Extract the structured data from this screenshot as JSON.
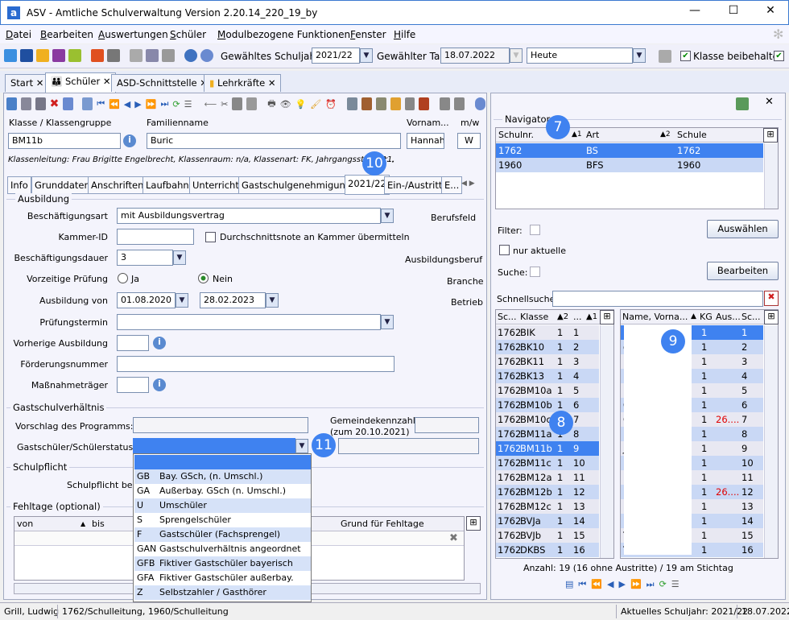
{
  "window": {
    "title": "ASV - Amtliche Schulverwaltung Version 2.20.14_220_19_by",
    "logo": "a",
    "minimize": "—",
    "maximize": "☐",
    "close": "✕"
  },
  "menu": [
    "Datei",
    "Bearbeiten",
    "Auswertungen",
    "Schüler",
    "Modulbezogene Funktionen",
    "Fenster",
    "Hilfe"
  ],
  "toolbar": {
    "schuljahr_label": "Gewähltes Schuljahr",
    "schuljahr_value": "2021/22",
    "tag_label": "Gewählter Tag",
    "tag_value": "18.07.2022",
    "heute_value": "Heute",
    "klasse_label": "Klasse beibehalten"
  },
  "tabs": [
    {
      "label": "Start"
    },
    {
      "label": "Schüler"
    },
    {
      "label": "ASD-Schnittstelle"
    },
    {
      "label": "Lehrkräfte"
    }
  ],
  "tab_close": "✕",
  "student": {
    "klasse_label": "Klasse / Klassengruppe",
    "klasse": "BM11b",
    "familienname_label": "Familienname",
    "familienname": "Buric",
    "vorname_label": "Vornam...",
    "vorname": "Hannah",
    "mw_label": "m/w",
    "mw": "W",
    "info": "Klassenleitung: Frau Brigitte Engelbrecht, Klassenraum: n/a, Klassenart: FK, Jahrgangsstufe: 11,",
    "info_tail": "r..."
  },
  "subtabs": [
    "Info",
    "Grunddaten",
    "Anschriften",
    "Laufbahn",
    "Unterricht",
    "Gastschulgenehmigung",
    "2021/22",
    "Ein-/Austritt",
    "E..."
  ],
  "ausbildung": {
    "section": "Ausbildung",
    "beschaeftigungsart_label": "Beschäftigungsart",
    "beschaeftigungsart": "mit Ausbildungsvertrag",
    "kammer_label": "Kammer-ID",
    "durchschnitt_label": "Durchschnittsnote an Kammer übermitteln",
    "dauer_label": "Beschäftigungsdauer",
    "dauer": "3",
    "vorzeitig_label": "Vorzeitige Prüfung",
    "ja": "Ja",
    "nein": "Nein",
    "von_label": "Ausbildung von",
    "von": "01.08.2020",
    "bis": "28.02.2023",
    "pruefung_label": "Prüfungstermin",
    "vorherige_label": "Vorherige Ausbildung",
    "foerder_label": "Förderungsnummer",
    "massnahme_label": "Maßnahmeträger",
    "berufsfeld": "Berufsfeld",
    "ausbildungsberuf": "Ausbildungsberuf",
    "branche": "Branche",
    "betrieb": "Betrieb"
  },
  "gast": {
    "section": "Gastschulverhältnis",
    "vorschlag_label": "Vorschlag des Programms:",
    "gemeinde_label": "Gemeindekennzahl",
    "gemeinde_sub": "(zum 20.10.2021)",
    "status_label": "Gastschüler/Schülerstatus",
    "schulpflicht_section": "Schulpflicht",
    "schulpflicht_label": "Schulpflicht ber"
  },
  "fehltage": {
    "section": "Fehltage (optional)",
    "cols": [
      "von",
      "bis",
      "Grund für Fehltage"
    ]
  },
  "dropdown": [
    {
      "code": "",
      "text": ""
    },
    {
      "code": "GB",
      "text": "Bay. GSch, (n. Umschl.)"
    },
    {
      "code": "GA",
      "text": "Außerbay. GSch (n. Umschl.)"
    },
    {
      "code": "U",
      "text": "Umschüler"
    },
    {
      "code": "S",
      "text": "Sprengelschüler"
    },
    {
      "code": "F",
      "text": "Gastschüler (Fachsprengel)"
    },
    {
      "code": "GAN",
      "text": "Gastschulverhältnis angeordnet"
    },
    {
      "code": "GFB",
      "text": "Fiktiver Gastschüler bayerisch"
    },
    {
      "code": "GFA",
      "text": "Fiktiver Gastschüler außerbay."
    },
    {
      "code": "Z",
      "text": "Selbstzahler / Gasthörer"
    }
  ],
  "navigator": {
    "title": "Navigator",
    "cols": [
      "Schulnr.",
      "Art",
      "Schule"
    ],
    "sort1": "▲1",
    "sort2": "▲2",
    "rows": [
      [
        "1762",
        "BS",
        "1762"
      ],
      [
        "1960",
        "BFS",
        "1960"
      ]
    ],
    "filter": "Filter:",
    "nur_aktuelle": "nur aktuelle",
    "suche": "Suche:",
    "auswaehlen": "Auswählen",
    "bearbeiten": "Bearbeiten",
    "schnellsuche": "Schnellsuche"
  },
  "klassen": {
    "cols": [
      "Sc...",
      "Klasse",
      "▲2",
      "...",
      "▲1"
    ],
    "rows": [
      [
        "1762",
        "BIK",
        "1",
        "1"
      ],
      [
        "1762",
        "BK10",
        "1",
        "2"
      ],
      [
        "1762",
        "BK11",
        "1",
        "3"
      ],
      [
        "1762",
        "BK13",
        "1",
        "4"
      ],
      [
        "1762",
        "BM10a",
        "1",
        "5"
      ],
      [
        "1762",
        "BM10b",
        "1",
        "6"
      ],
      [
        "1762",
        "BM10c",
        "1",
        "7"
      ],
      [
        "1762",
        "BM11a",
        "1",
        "8"
      ],
      [
        "1762",
        "BM11b",
        "1",
        "9"
      ],
      [
        "1762",
        "BM11c",
        "1",
        "10"
      ],
      [
        "1762",
        "BM12a",
        "1",
        "11"
      ],
      [
        "1762",
        "BM12b",
        "1",
        "12"
      ],
      [
        "1762",
        "BM12c",
        "1",
        "13"
      ],
      [
        "1762",
        "BVJa",
        "1",
        "14"
      ],
      [
        "1762",
        "BVJb",
        "1",
        "15"
      ],
      [
        "1762",
        "DKBS",
        "1",
        "16"
      ]
    ]
  },
  "schueler": {
    "cols": [
      "Name, Vorna...",
      "▲",
      "KG",
      "Aus...",
      "Sc..."
    ],
    "rows": [
      [
        "E",
        "1",
        "",
        "1"
      ],
      [
        "d",
        "1",
        "",
        "2"
      ],
      [
        "D",
        "1",
        "",
        "3"
      ],
      [
        "E",
        "1",
        "",
        "4"
      ],
      [
        "E",
        "1",
        "",
        "5"
      ],
      [
        "C",
        "1",
        "",
        "6"
      ],
      [
        "C",
        "1",
        "26....",
        "7"
      ],
      [
        "H",
        "1",
        "",
        "8"
      ],
      [
        "J",
        "1",
        "",
        "9"
      ],
      [
        "N",
        "1",
        "",
        "10"
      ],
      [
        "N",
        "1",
        "",
        "11"
      ],
      [
        "N",
        "1",
        "26....",
        "12"
      ],
      [
        "N",
        "1",
        "",
        "13"
      ],
      [
        "P",
        "1",
        "",
        "14"
      ],
      [
        "T",
        "1",
        "",
        "15"
      ],
      [
        "T",
        "1",
        "",
        "16"
      ]
    ]
  },
  "anzahl": "Anzahl: 19 (16 ohne Austritte) / 19 am Stichtag",
  "badges": [
    "7",
    "8",
    "9",
    "10",
    "11"
  ],
  "statusbar": {
    "user": "Grill, Ludwig",
    "role": "1762/Schulleitung, 1960/Schulleitung",
    "schuljahr": "Aktuelles Schuljahr: 2021/22",
    "date": "18.07.2022"
  },
  "colors": {
    "accent": "#3f82f0",
    "row_even": "#c9d8f5",
    "row_odd": "#e8e8f2",
    "warn": "#e00000"
  }
}
